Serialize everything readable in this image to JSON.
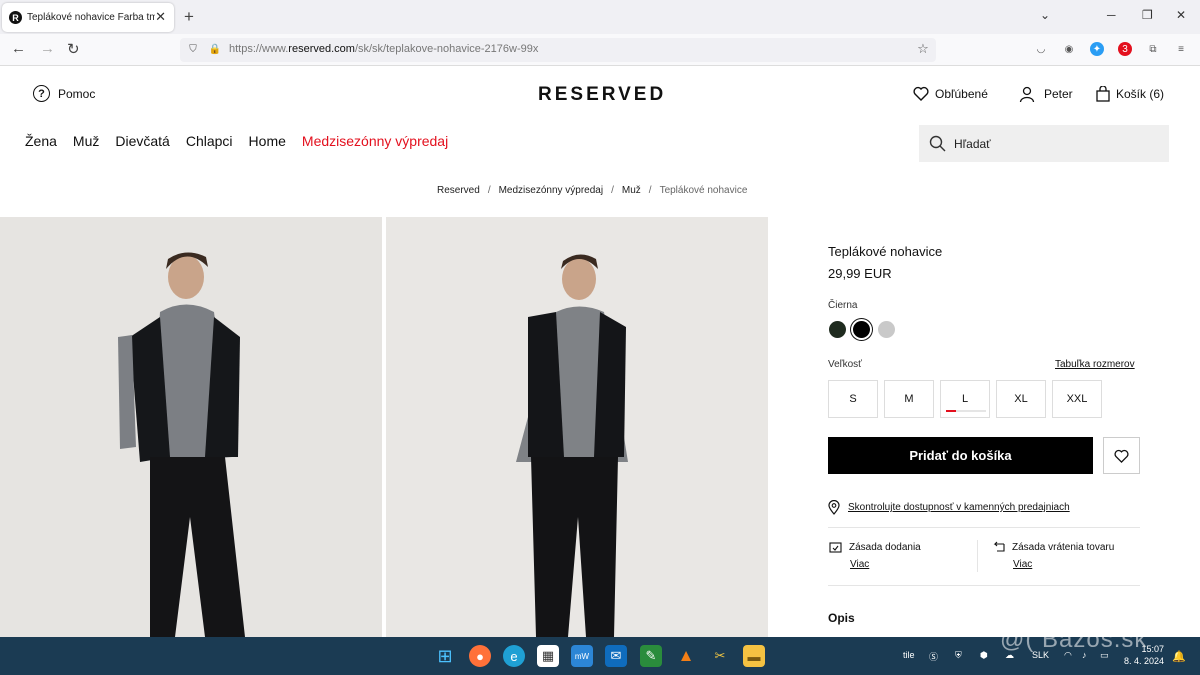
{
  "browser": {
    "tab_title": "Teplákové nohavice Farba tmavo",
    "tab_favicon": "R",
    "url_prefix": "https://www.",
    "url_domain": "reserved.com",
    "url_path": "/sk/sk/teplakove-nohavice-2176w-99x",
    "ext_badge": "3"
  },
  "header": {
    "help_label": "Pomoc",
    "logo": "RESERVED",
    "favorites_label": "Obľúbené",
    "user_label": "Peter",
    "cart_label": "Košík (6)",
    "search_placeholder": "Hľadať"
  },
  "nav": {
    "items": [
      "Žena",
      "Muž",
      "Dievčatá",
      "Chlapci",
      "Home"
    ],
    "sale": "Medzisezónny výpredaj"
  },
  "breadcrumb": [
    "Reserved",
    "Medzisezónny výpredaj",
    "Muž",
    "Teplákové nohavice"
  ],
  "product": {
    "name": "Teplákové nohavice",
    "price": "29,99 EUR",
    "color_label": "Čierna",
    "colors": [
      "#1f2b1f",
      "#000000",
      "#c9c9c9"
    ],
    "size_label": "Veľkosť",
    "size_chart": "Tabuľka rozmerov",
    "sizes": [
      "S",
      "M",
      "L",
      "XL",
      "XXL"
    ],
    "low_stock_size": "L",
    "low_stock_level": 0.25,
    "add_to_cart": "Pridať do košíka",
    "stock_check": "Skontrolujte dostupnosť v kamenných predajniach",
    "delivery_label": "Zásada dodania",
    "delivery_more": "Viac",
    "return_label": "Zásada vrátenia tovaru",
    "return_more": "Viac",
    "description_heading": "Opis"
  },
  "taskbar": {
    "lang": "SLK",
    "time": "15:07",
    "date": "8. 4. 2024",
    "tile_label": "tile"
  },
  "watermark": "@( Bazos.sk"
}
